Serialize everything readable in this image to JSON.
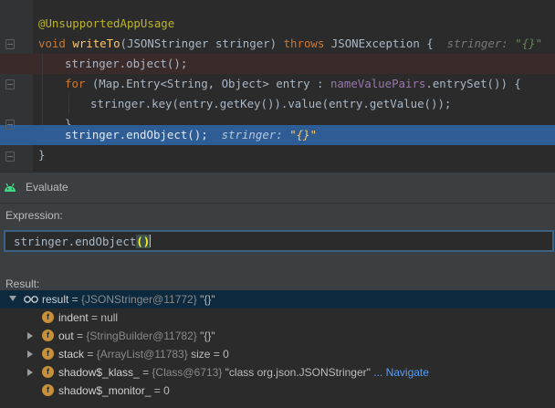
{
  "editor": {
    "lines": [
      {
        "annotation": "@UnsupportedAppUsage"
      },
      {
        "kw_void": "void ",
        "method": "writeTo",
        "params": "(JSONStringer stringer) ",
        "kw_throws": "throws",
        "rest": " JSONException {  ",
        "hint_label": "stringer: ",
        "hint_value": "\"{}\""
      },
      {
        "code": "stringer.object();"
      },
      {
        "kw_for": "for",
        "part1": " (Map.Entry<String, Object> entry : ",
        "field": "nameValuePairs",
        "part2": ".entrySet()) {"
      },
      {
        "code": "stringer.key(entry.getKey()).value(entry.getValue());"
      },
      {
        "code": "}"
      },
      {
        "code": "stringer.endObject();",
        "hint_label": "stringer: ",
        "hint_value": "\"{}\""
      },
      {
        "code": "}"
      }
    ]
  },
  "evaluate": {
    "title": "Evaluate",
    "expression_label": "Expression:",
    "expression_pre": "stringer.endObject",
    "expression_open": "(",
    "expression_close": ")",
    "result_label": "Result:",
    "rows": [
      {
        "name": "result",
        "eq": " = ",
        "type": "{JSONStringer@11772}",
        "value": " \"{}\""
      },
      {
        "name": "indent",
        "eq": " = ",
        "value": "null"
      },
      {
        "name": "out",
        "eq": " = ",
        "type": "{StringBuilder@11782}",
        "value": " \"{}\""
      },
      {
        "name": "stack",
        "eq": " = ",
        "type": "{ArrayList@11783}",
        "value": "  size = 0"
      },
      {
        "name": "shadow$_klass_",
        "eq": " = ",
        "type": "{Class@6713}",
        "value": " \"class org.json.JSONStringer\"",
        "link": " ... Navigate"
      },
      {
        "name": "shadow$_monitor_",
        "eq": " = ",
        "value": "0"
      }
    ],
    "field_icon_letter": "f"
  },
  "colors": {
    "editor_bg": "#2b2b2b",
    "execution_line": "#2d5d94",
    "error_line": "#3b2a2a",
    "keyword": "#cc7832",
    "method": "#ffc66d",
    "annotation": "#bbb529",
    "field": "#9876aa",
    "link": "#589df6"
  }
}
